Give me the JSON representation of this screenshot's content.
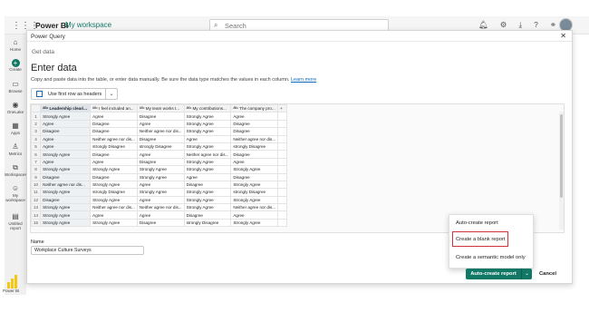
{
  "topbar": {
    "brand": "Power BI",
    "workspace": "My workspace",
    "search_placeholder": "Search"
  },
  "leftnav": {
    "items": [
      {
        "label": "Home",
        "icon": "home-icon"
      },
      {
        "label": "Create",
        "icon": "plus-icon"
      },
      {
        "label": "Browse",
        "icon": "folder-icon"
      },
      {
        "label": "OneLake",
        "icon": "onelake-icon"
      },
      {
        "label": "Apps",
        "icon": "apps-icon"
      },
      {
        "label": "Metrics",
        "icon": "trophy-icon"
      },
      {
        "label": "Workspaces",
        "icon": "workspaces-icon"
      },
      {
        "label": "My workspace",
        "icon": "my-workspace-icon"
      },
      {
        "label": "Untitled report",
        "icon": "report-icon"
      }
    ],
    "footer_label": "Power BI"
  },
  "dialog": {
    "title": "Power Query",
    "breadcrumb": "Get data",
    "heading": "Enter data",
    "description": "Copy and paste data into the table, or enter data manually. Be sure the data type matches the values in each column.",
    "learn_more": "Learn more",
    "first_row_btn": "Use first row as headers",
    "name_label": "Name",
    "name_value": "Workplace Culture Surveys",
    "auto_create_btn": "Auto-create report",
    "cancel_btn": "Cancel"
  },
  "grid": {
    "columns": [
      "Leadership cleari...",
      "I feel included an...",
      "My team works t...",
      "My contributions...",
      "The company pro..."
    ],
    "add_column": "+",
    "rows": [
      [
        "Strongly Agree",
        "Agree",
        "Disagree",
        "Strongly Agree",
        "Agree"
      ],
      [
        "Agree",
        "Disagree",
        "Agree",
        "Strongly Agree",
        "Disagree"
      ],
      [
        "Disagree",
        "Disagree",
        "Neither agree nor dis...",
        "Strongly Agree",
        "Disagree"
      ],
      [
        "Agree",
        "Neither agree nor dis...",
        "Disagree",
        "Agree",
        "Neither agree nor dis..."
      ],
      [
        "Agree",
        "strongly Disagree",
        "strongly Disagree",
        "Strongly Agree",
        "strongly Disagree"
      ],
      [
        "Strongly Agree",
        "Disagree",
        "Agree",
        "Neither agree nor dis...",
        "Disagree"
      ],
      [
        "Agree",
        "Agree",
        "Disagree",
        "Strongly Agree",
        "Agree"
      ],
      [
        "Strongly Agree",
        "Strongly Agree",
        "Strongly Agree",
        "Strongly Agree",
        "Strongly Agree"
      ],
      [
        "Disagree",
        "Disagree",
        "Strongly Agree",
        "Agree",
        "Disagree"
      ],
      [
        "Neither agree nor dis...",
        "Strongly Agree",
        "Agree",
        "Disagree",
        "Strongly Agree"
      ],
      [
        "Strongly Agree",
        "strongly Disagree",
        "Strongly Agree",
        "Strongly Agree",
        "strongly Disagree"
      ],
      [
        "Disagree",
        "Strongly Agree",
        "Agree",
        "Strongly Agree",
        "Strongly Agree"
      ],
      [
        "Strongly Agree",
        "Neither agree nor dis...",
        "Neither agree nor dis...",
        "Strongly Agree",
        "Neither agree nor dis..."
      ],
      [
        "Strongly Agree",
        "Agree",
        "Agree",
        "Disagree",
        "Agree"
      ],
      [
        "Strongly Agree",
        "Strongly Agree",
        "Disagree",
        "strongly Disagree",
        "Strongly Agree"
      ]
    ]
  },
  "popup": {
    "items": [
      "Auto-create report",
      "Create a blank report",
      "Create a semantic model only"
    ]
  },
  "colors": {
    "accent": "#117865",
    "highlight": "#d13438",
    "link": "#0f6cbd"
  }
}
